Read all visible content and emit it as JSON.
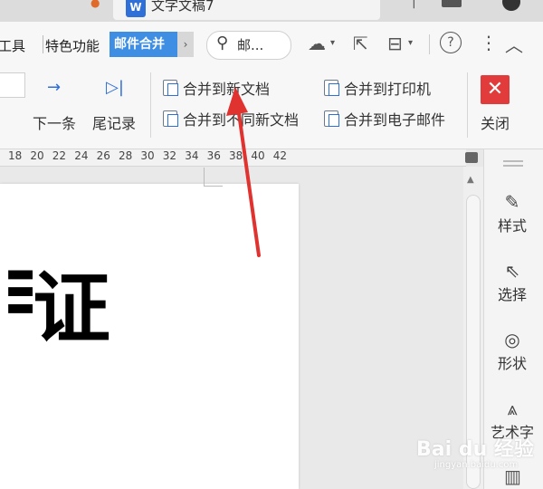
{
  "titlebar": {
    "doc_tab_title": "文字文稿7",
    "doc_tab_icon": "W"
  },
  "menu": {
    "tools": "工具",
    "special": "特色功能",
    "mail_merge": "邮件合并",
    "more_arrow": "›",
    "search_text": "邮..."
  },
  "ribbon": {
    "next_record": "下一条",
    "last_record": "尾记录",
    "merge_new_doc": "合并到新文档",
    "merge_diff_doc": "合并到不同新文档",
    "merge_printer": "合并到打印机",
    "merge_email": "合并到电子邮件",
    "close": "关闭"
  },
  "ruler": {
    "ticks": [
      "18",
      "20",
      "22",
      "24",
      "26",
      "28",
      "30",
      "32",
      "34",
      "36",
      "38",
      "40",
      "42"
    ]
  },
  "document": {
    "visible_text": "证"
  },
  "right_panel": {
    "style": "样式",
    "select": "选择",
    "shape": "形状",
    "wordart": "艺术字"
  },
  "watermark": {
    "brand": "Bai du 经验",
    "url": "jingyan.baidu.com"
  },
  "colors": {
    "accent": "#3e8ee3",
    "close_red": "#e23b3b",
    "arrow_red": "#e0322f"
  }
}
